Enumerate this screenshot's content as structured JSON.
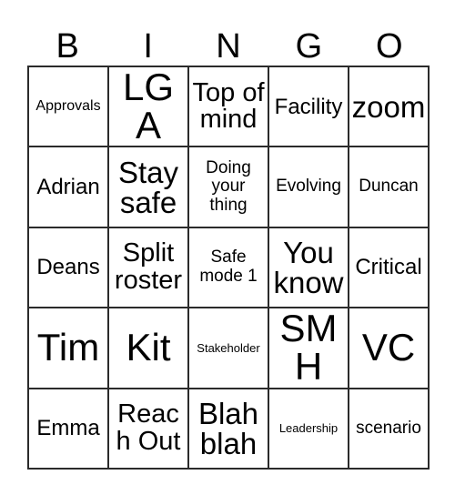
{
  "card": {
    "header": {
      "letters": [
        "B",
        "I",
        "N",
        "G",
        "O"
      ]
    },
    "rows": [
      [
        {
          "text": "Approvals",
          "size": "fs-sm"
        },
        {
          "text": "LGA",
          "size": "fs-huge"
        },
        {
          "text": "Top of mind",
          "size": "fs-xl"
        },
        {
          "text": "Facility",
          "size": "fs-lg"
        },
        {
          "text": "zoom",
          "size": "fs-xxl"
        }
      ],
      [
        {
          "text": "Adrian",
          "size": "fs-lg"
        },
        {
          "text": "Stay safe",
          "size": "fs-xxl"
        },
        {
          "text": "Doing your thing",
          "size": "fs-md"
        },
        {
          "text": "Evolving",
          "size": "fs-md"
        },
        {
          "text": "Duncan",
          "size": "fs-md"
        }
      ],
      [
        {
          "text": "Deans",
          "size": "fs-lg"
        },
        {
          "text": "Split roster",
          "size": "fs-xl"
        },
        {
          "text": "Safe mode 1",
          "size": "fs-md"
        },
        {
          "text": "You know",
          "size": "fs-xxl"
        },
        {
          "text": "Critical",
          "size": "fs-lg"
        }
      ],
      [
        {
          "text": "Tim",
          "size": "fs-huge"
        },
        {
          "text": "Kit",
          "size": "fs-huge"
        },
        {
          "text": "Stakeholder",
          "size": "fs-xs"
        },
        {
          "text": "SMH",
          "size": "fs-huge"
        },
        {
          "text": "VC",
          "size": "fs-huge"
        }
      ],
      [
        {
          "text": "Emma",
          "size": "fs-lg"
        },
        {
          "text": "Reach Out",
          "size": "fs-xl"
        },
        {
          "text": "Blah blah",
          "size": "fs-xxl"
        },
        {
          "text": "Leadership",
          "size": "fs-xs"
        },
        {
          "text": "scenario",
          "size": "fs-md"
        }
      ]
    ]
  }
}
